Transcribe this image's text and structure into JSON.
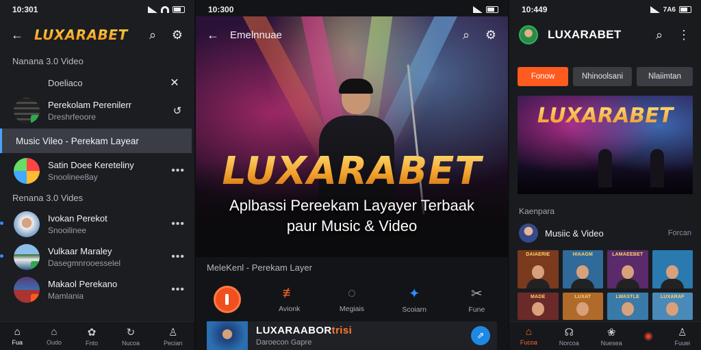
{
  "panel1": {
    "status_time": "10:301",
    "brand": "LUXARABET",
    "section1": "Nanana 3.0 Video",
    "subrow": "Doeliaco",
    "items1": [
      {
        "title": "Perekolam Perenilerr",
        "sub": "Dreshrfeoore"
      },
      {
        "title": "Music Vileo - Perekam Layear",
        "sub": ""
      },
      {
        "title": "Satin Doee Kereteliny",
        "sub": "Snoolinee8ay"
      }
    ],
    "section2": "Renana 3.0 Vides",
    "items2": [
      {
        "title": "Ivokan Perekot",
        "sub": "Snooilinee"
      },
      {
        "title": "Vulkaar Maraley",
        "sub": "Dasegmnrooesselel"
      },
      {
        "title": "Makaol Perekano",
        "sub": "Mamlania"
      }
    ],
    "nav": [
      {
        "icon": "home-icon",
        "glyph": "⌂",
        "label": "Fua"
      },
      {
        "icon": "house-outline-icon",
        "glyph": "⌂",
        "label": "Oudo"
      },
      {
        "icon": "apps-icon",
        "glyph": "✿",
        "label": "Fnto"
      },
      {
        "icon": "refresh-icon",
        "glyph": "↻",
        "label": "Nucoa"
      },
      {
        "icon": "person-icon",
        "glyph": "👤",
        "label": "Pecian"
      }
    ]
  },
  "panel2": {
    "status_time": "10:300",
    "title": "Emelnnuae",
    "hero_brand": "LUXARABET",
    "hero_line1": "Aplbassi Pereekam Layayer Terbaak",
    "hero_line2": "paur Music & Video",
    "section": "MeleKenl - Perekam Layer",
    "actions": [
      {
        "icon": "record-icon",
        "label": ""
      },
      {
        "icon": "equalizer-icon",
        "glyph": "⇟",
        "label": "Avionk"
      },
      {
        "icon": "chat-icon",
        "glyph": "◎",
        "label": "Megiais"
      },
      {
        "icon": "star-icon",
        "glyph": "✦",
        "label": "Scoiarn"
      },
      {
        "icon": "cut-icon",
        "glyph": "✂",
        "label": "Fune"
      }
    ],
    "card_title_a": "LUXARAABOR",
    "card_title_b": "trisi",
    "card_sub": "Daroecon Gapre"
  },
  "panel3": {
    "status_time": "10:449",
    "status_right": "7A6",
    "brand": "LUXARABET",
    "chips": [
      "Fonow",
      "Nhinoolsani",
      "Nlaiimtan"
    ],
    "banner_brand": "LUXARABET",
    "section": "Kaenpara",
    "row_title": "Musiic & Video",
    "row_meta": "Forcan",
    "tiles": [
      {
        "label": "DAIAERIE",
        "color": "#7a3a1e"
      },
      {
        "label": "HIAAGM",
        "color": "#2f6a9a"
      },
      {
        "label": "LAMAEEBET",
        "color": "#5a2a6a"
      },
      {
        "label": "",
        "color": "#2a7ab0"
      },
      {
        "label": "MADE",
        "color": "#6a2a2a"
      },
      {
        "label": "LUXAT",
        "color": "#b06a2a"
      },
      {
        "label": "LWASTLE",
        "color": "#3a7aa8"
      },
      {
        "label": "LUXARAF",
        "color": "#4a8ab8"
      }
    ],
    "nav": [
      {
        "icon": "home-icon",
        "glyph": "⌂",
        "label": "Fucoa"
      },
      {
        "icon": "headset-icon",
        "glyph": "☊",
        "label": "Norcoa"
      },
      {
        "icon": "gallery-icon",
        "glyph": "❀",
        "label": "Nuesea"
      },
      {
        "icon": "record-icon",
        "glyph": "◉",
        "label": ""
      },
      {
        "icon": "person-icon",
        "glyph": "👤",
        "label": "Fuuei"
      }
    ]
  },
  "colors": {
    "accent": "#ff5a1f",
    "selection": "#3a3d45",
    "brand_gold": "#f2a12c"
  }
}
